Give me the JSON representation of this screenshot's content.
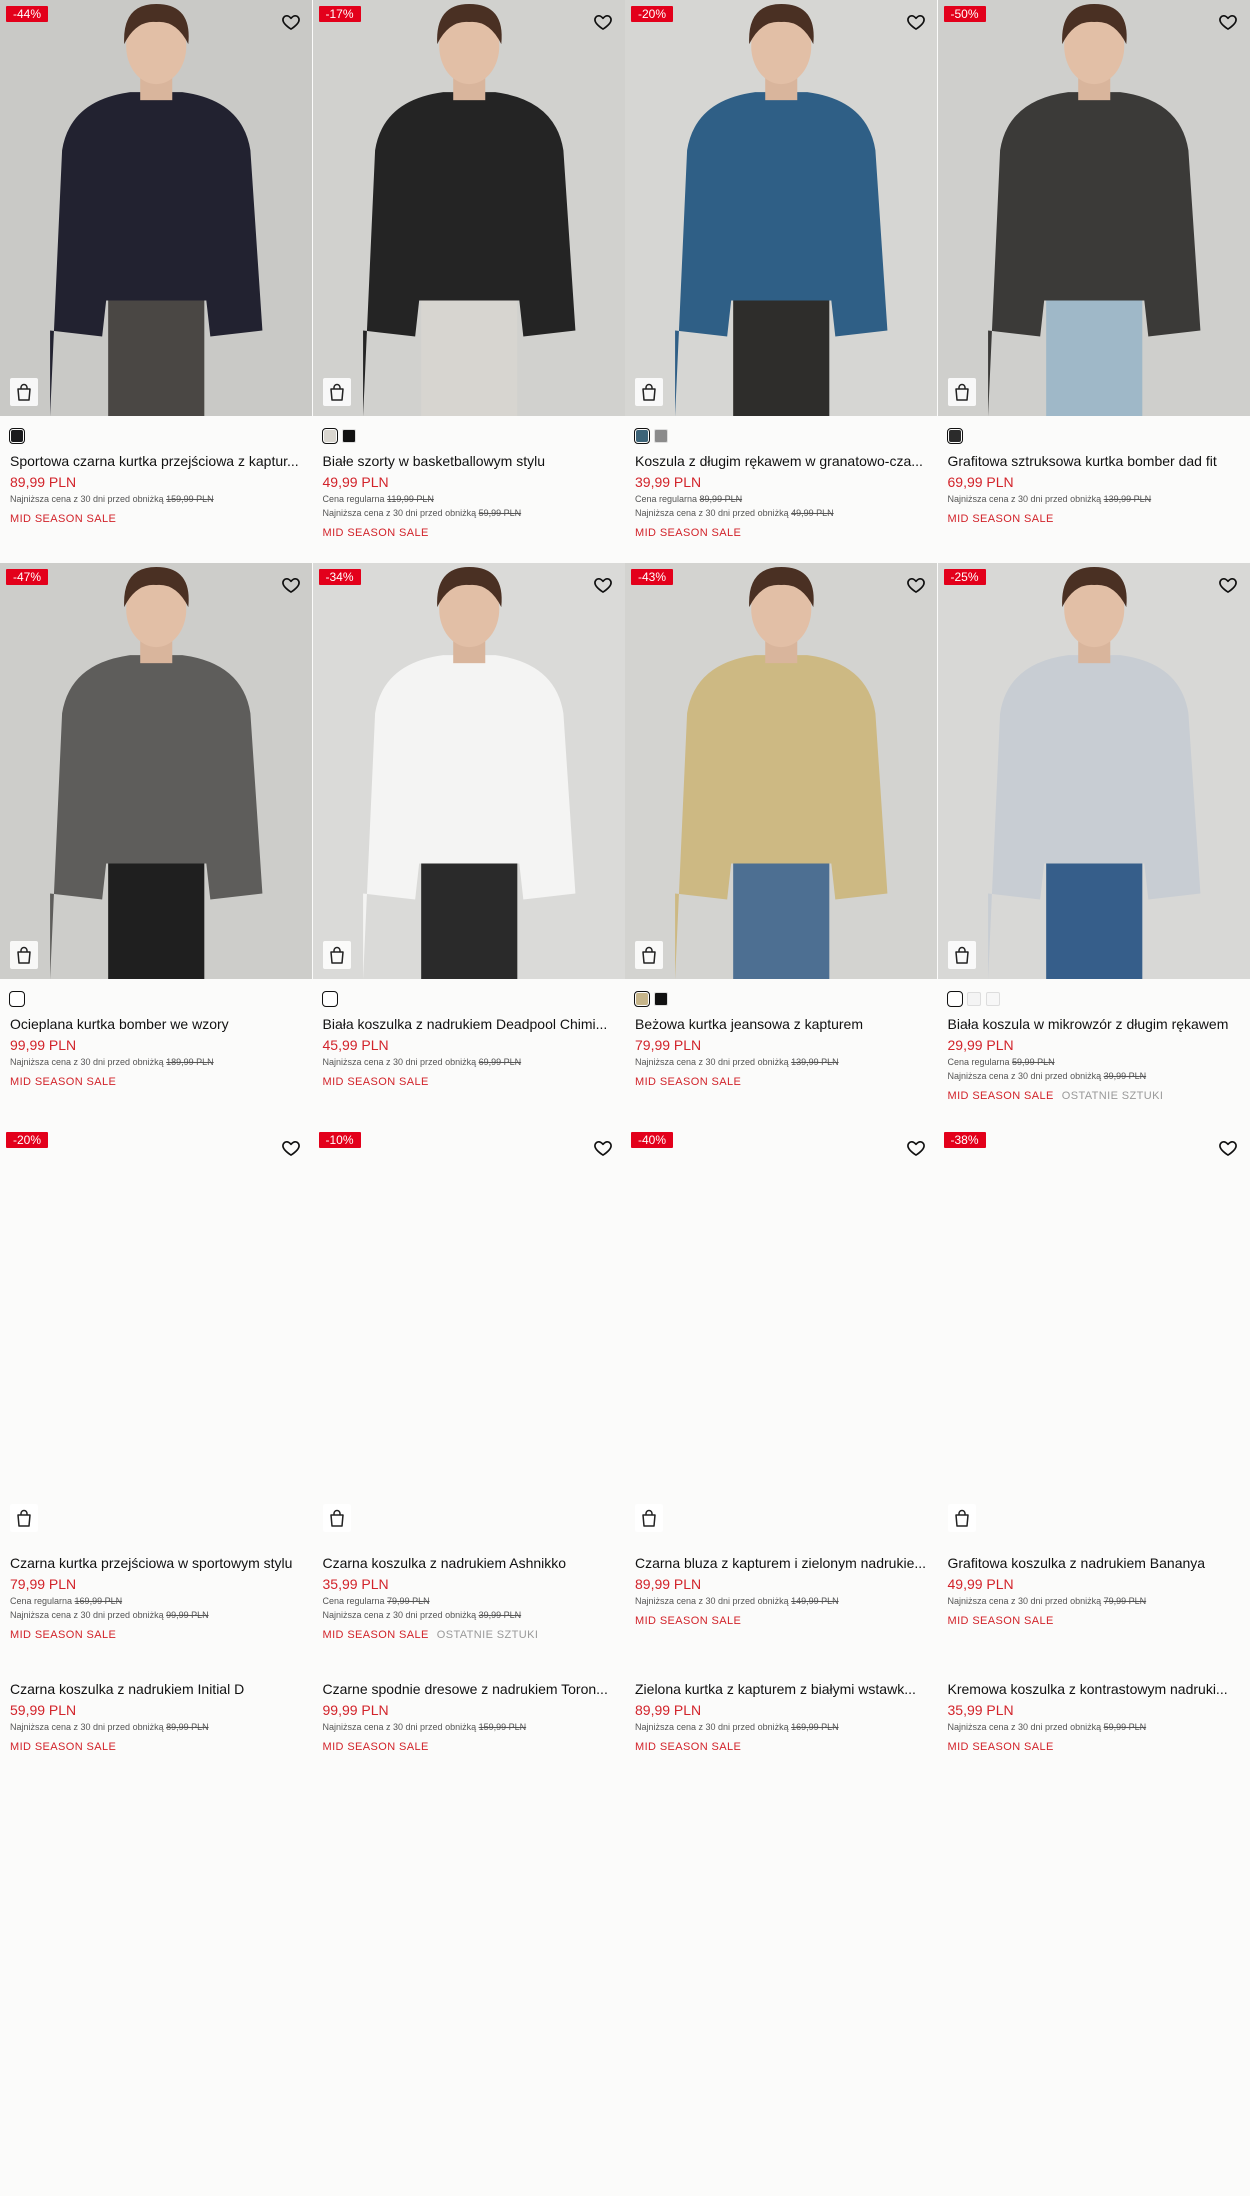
{
  "strings": {
    "lowest_prefix": "Najniższa cena z 30 dni przed obniżką",
    "regular_prefix": "Cena regularna",
    "sale_tag": "MID SEASON SALE",
    "last_items_tag": "OSTATNIE SZTUKI"
  },
  "colors": {
    "accent": "#d2232a",
    "badge": "#e3001b",
    "background": "#fbfbfa"
  },
  "icons": {
    "favorite": "heart-icon",
    "bag": "shopping-bag-icon"
  },
  "products": [
    {
      "badge": "-44%",
      "name": "Sportowa czarna kurtka przejściowa z kaptur...",
      "price": "89,99 PLN",
      "regular": "",
      "lowest": "159,99 PLN",
      "last": false,
      "swatches": [
        "#1b1b1d"
      ],
      "bg": "#c9c9c6",
      "garment": "#222230",
      "pants": "#4a4744"
    },
    {
      "badge": "-17%",
      "name": "Białe szorty w basketballowym stylu",
      "price": "49,99 PLN",
      "regular": "119,99 PLN",
      "lowest": "59,99 PLN",
      "last": false,
      "swatches": [
        "#d9d6cf",
        "#111111"
      ],
      "bg": "#d1d1ce",
      "garment": "#242424",
      "pants": "#d7d5d0"
    },
    {
      "badge": "-20%",
      "name": "Koszula z długim rękawem w granatowo-cza...",
      "price": "39,99 PLN",
      "regular": "89,99 PLN",
      "lowest": "49,99 PLN",
      "last": false,
      "swatches": [
        "#3d6478",
        "#8b8b8b"
      ],
      "bg": "#d6d6d3",
      "garment": "#2f5f86",
      "pants": "#2e2d2b"
    },
    {
      "badge": "-50%",
      "name": "Grafitowa sztruksowa kurtka bomber dad fit",
      "price": "69,99 PLN",
      "regular": "",
      "lowest": "139,99 PLN",
      "last": false,
      "swatches": [
        "#2b2b2b"
      ],
      "bg": "#cfcfcc",
      "garment": "#3b3a38",
      "pants": "#9fb8c8"
    },
    {
      "badge": "-47%",
      "name": "Ocieplana kurtka bomber we wzory",
      "price": "99,99 PLN",
      "regular": "",
      "lowest": "189,99 PLN",
      "last": false,
      "swatches": [
        "#ffffff"
      ],
      "bg": "#cdcdca",
      "garment": "#5e5d5b",
      "pants": "#1f1f1f"
    },
    {
      "badge": "-34%",
      "name": "Biała koszulka z nadrukiem Deadpool Chimi...",
      "price": "45,99 PLN",
      "regular": "",
      "lowest": "69,99 PLN",
      "last": false,
      "swatches": [
        "#ffffff"
      ],
      "bg": "#dadad8",
      "garment": "#f4f4f3",
      "pants": "#2a2a2a"
    },
    {
      "badge": "-43%",
      "name": "Beżowa kurtka jeansowa z kapturem",
      "price": "79,99 PLN",
      "regular": "",
      "lowest": "139,99 PLN",
      "last": false,
      "swatches": [
        "#c6b58a",
        "#111111"
      ],
      "bg": "#d3d3d0",
      "garment": "#cdb983",
      "pants": "#4d6f92"
    },
    {
      "badge": "-25%",
      "name": "Biała koszula w mikrowzór z długim rękawem",
      "price": "29,99 PLN",
      "regular": "59,99 PLN",
      "lowest": "39,99 PLN",
      "last": true,
      "swatches": [
        "#ffffff",
        "#f4f4f4",
        "#f7f7f7"
      ],
      "bg": "#d8d8d6",
      "garment": "#c8cdd3",
      "pants": "#365e8a"
    },
    {
      "badge": "-20%",
      "name": "Czarna kurtka przejściowa w sportowym stylu",
      "price": "79,99 PLN",
      "regular": "169,99 PLN",
      "lowest": "99,99 PLN",
      "last": false,
      "swatches": [],
      "bg": "",
      "garment": "",
      "pants": ""
    },
    {
      "badge": "-10%",
      "name": "Czarna koszulka z nadrukiem Ashnikko",
      "price": "35,99 PLN",
      "regular": "79,99 PLN",
      "lowest": "39,99 PLN",
      "last": true,
      "swatches": [],
      "bg": "",
      "garment": "",
      "pants": ""
    },
    {
      "badge": "-40%",
      "name": "Czarna bluza z kapturem i zielonym nadrukie...",
      "price": "89,99 PLN",
      "regular": "",
      "lowest": "149,99 PLN",
      "last": false,
      "swatches": [],
      "bg": "",
      "garment": "",
      "pants": ""
    },
    {
      "badge": "-38%",
      "name": "Grafitowa koszulka z nadrukiem Bananya",
      "price": "49,99 PLN",
      "regular": "",
      "lowest": "79,99 PLN",
      "last": false,
      "swatches": [],
      "bg": "",
      "garment": "",
      "pants": ""
    },
    {
      "badge": "",
      "name": "Czarna koszulka z nadrukiem Initial D",
      "price": "59,99 PLN",
      "regular": "",
      "lowest": "89,99 PLN",
      "last": false,
      "swatches": [],
      "bg": "",
      "garment": "",
      "pants": ""
    },
    {
      "badge": "",
      "name": "Czarne spodnie dresowe z nadrukiem Toron...",
      "price": "99,99 PLN",
      "regular": "",
      "lowest": "159,99 PLN",
      "last": false,
      "swatches": [],
      "bg": "",
      "garment": "",
      "pants": ""
    },
    {
      "badge": "",
      "name": "Zielona kurtka z kapturem z białymi wstawk...",
      "price": "89,99 PLN",
      "regular": "",
      "lowest": "169,99 PLN",
      "last": false,
      "swatches": [],
      "bg": "",
      "garment": "",
      "pants": ""
    },
    {
      "badge": "",
      "name": "Kremowa koszulka z kontrastowym nadruki...",
      "price": "35,99 PLN",
      "regular": "",
      "lowest": "59,99 PLN",
      "last": false,
      "swatches": [],
      "bg": "",
      "garment": "",
      "pants": ""
    }
  ]
}
